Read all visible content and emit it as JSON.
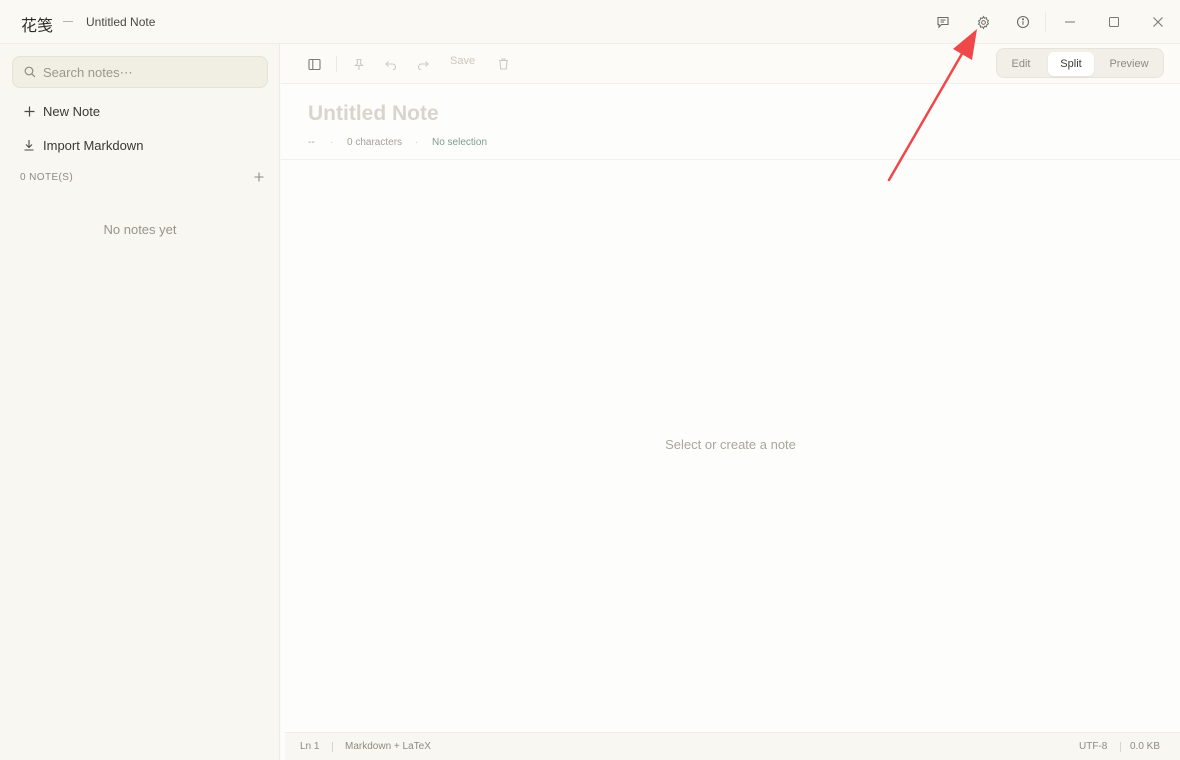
{
  "titlebar": {
    "app_name": "花笺",
    "window_title": "Untitled Note"
  },
  "sidebar": {
    "search_placeholder": "Search notes⋯",
    "new_note_label": "New Note",
    "import_label": "Import Markdown",
    "notes_count_label": "0 NOTE(S)",
    "empty_label": "No notes yet"
  },
  "toolbar": {
    "save_label": "Save",
    "view_modes": [
      "Edit",
      "Split",
      "Preview"
    ],
    "active_view": "Split"
  },
  "note": {
    "title": "Untitled Note",
    "meta_date": "--",
    "meta_chars": "0 characters",
    "meta_selection": "No selection"
  },
  "editor": {
    "empty_label": "Select or create a note"
  },
  "statusbar": {
    "line": "Ln 1",
    "mode": "Markdown + LaTeX",
    "encoding": "UTF-8",
    "size": "0.0 KB"
  },
  "colors": {
    "accent_arrow": "#f0474b",
    "background": "#fbfaf6",
    "sidebar_bg": "#f8f7f2"
  }
}
